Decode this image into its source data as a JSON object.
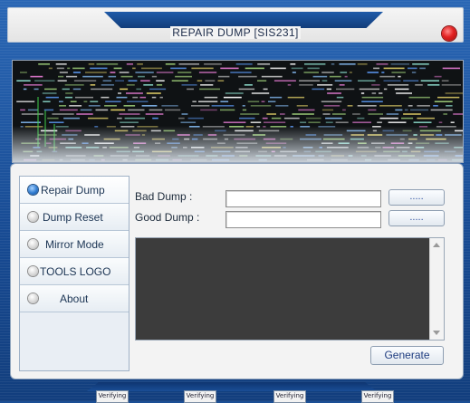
{
  "window": {
    "title": "REPAIR  DUMP [SIS231]",
    "close_icon": "close-red-dot-icon",
    "accent_color": "#1b4f95",
    "close_color": "#e32222"
  },
  "banner": {
    "image": "terminal-hexdump-screenshot"
  },
  "sidebar": {
    "items": [
      {
        "label": "Repair Dump",
        "selected": true
      },
      {
        "label": "Dump Reset",
        "selected": false
      },
      {
        "label": "Mirror Mode",
        "selected": false
      },
      {
        "label": "TOOLS LOGO",
        "selected": false
      },
      {
        "label": "About",
        "selected": false
      }
    ]
  },
  "form": {
    "bad_dump_label": "Bad Dump :",
    "bad_dump_value": "",
    "bad_browse_label": ".....",
    "good_dump_label": "Good Dump :",
    "good_dump_value": "",
    "good_browse_label": ".....",
    "log_text": "",
    "generate_label": "Generate"
  },
  "footer": {
    "badges": [
      "Verifying",
      "Verifying",
      "Verifying",
      "Verifying"
    ]
  }
}
